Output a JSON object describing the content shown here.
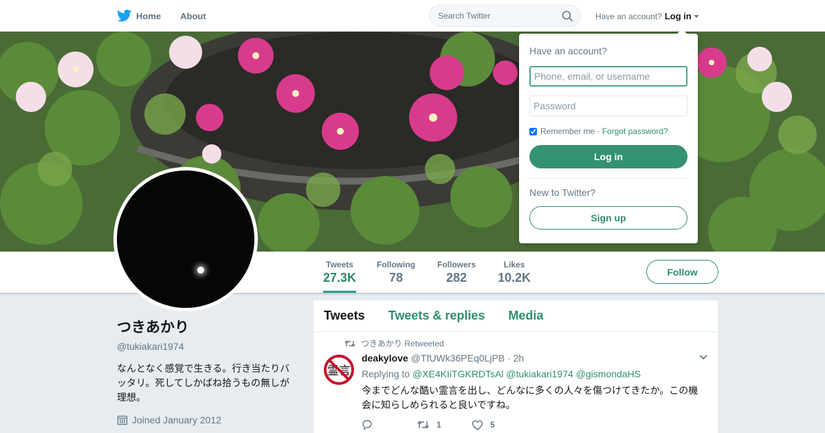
{
  "colors": {
    "accent": "#2f8f6f",
    "accent_fill": "#359271",
    "bird": "#1da1f2"
  },
  "nav": {
    "home_label": "Home",
    "about_label": "About",
    "search_placeholder": "Search Twitter",
    "account_prompt": "Have an account?",
    "login_label": "Log in"
  },
  "profile": {
    "name": "つきあかり",
    "handle": "@tukiakari1974",
    "bio": "なんとなく感覚で生きる。行き当たりバッタリ。死してしかばね拾うもの無しが理想。",
    "joined": "Joined January 2012"
  },
  "stats": [
    {
      "label": "Tweets",
      "value": "27.3K"
    },
    {
      "label": "Following",
      "value": "78"
    },
    {
      "label": "Followers",
      "value": "282"
    },
    {
      "label": "Likes",
      "value": "10.2K"
    }
  ],
  "follow_label": "Follow",
  "tabs": [
    "Tweets",
    "Tweets & replies",
    "Media"
  ],
  "tweet": {
    "retweeted_by": "つきあかり",
    "retweeted_label": "Retweeted",
    "name": "deakylove",
    "handle": "@TfUWk36PEq0LjPB",
    "time": "· 2h",
    "replying_to_label": "Replying to",
    "reply_handles": [
      "@XE4KIiTGKRDTsAl",
      "@tukiakari1974",
      "@gismondaHS"
    ],
    "text": "今までどんな酷い霊言を出し、どんなに多くの人々を傷つけてきたか。この機会に知らしめられると良いですね。",
    "avatar_text": "霊言",
    "retweets": "1",
    "likes": "5"
  },
  "login_dropdown": {
    "title": "Have an account?",
    "username_placeholder": "Phone, email, or username",
    "password_placeholder": "Password",
    "remember_label": "Remember me ·",
    "forgot_label": "Forgot password?",
    "login_button": "Log in",
    "new_prompt": "New to Twitter?",
    "signup_button": "Sign up"
  }
}
